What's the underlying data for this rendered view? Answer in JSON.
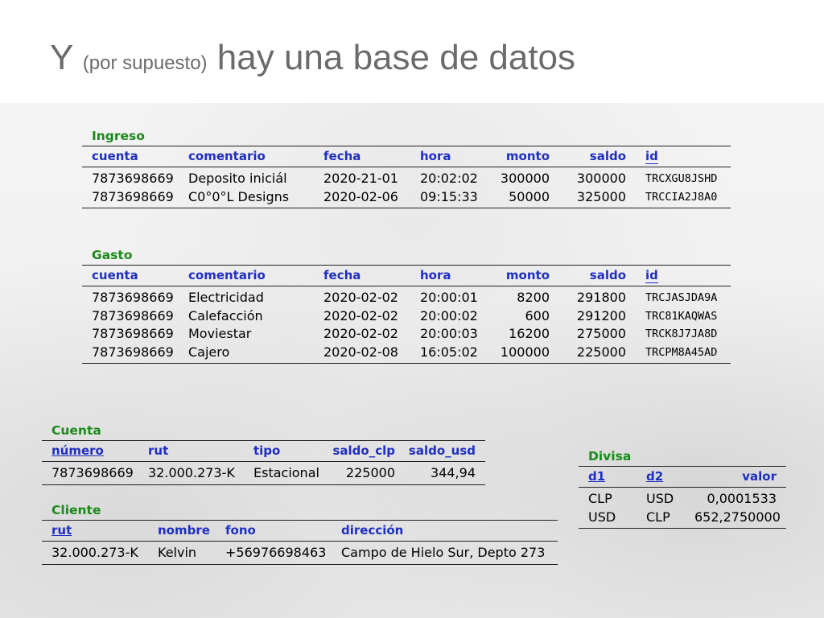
{
  "slide": {
    "title_pre": "Y",
    "title_paren": "(por supuesto)",
    "title_post": "hay una base de datos"
  },
  "ingreso": {
    "caption": "Ingreso",
    "headers": [
      "cuenta",
      "comentario",
      "fecha",
      "hora",
      "monto",
      "saldo",
      "id"
    ],
    "rows": [
      [
        "7873698669",
        "Deposito iniciál",
        "2020-21-01",
        "20:02:02",
        "300000",
        "300000",
        "TRCXGU8JSHD"
      ],
      [
        "7873698669",
        "C0°0°L Designs",
        "2020-02-06",
        "09:15:33",
        "50000",
        "325000",
        "TRCCIA2J8A0"
      ]
    ]
  },
  "gasto": {
    "caption": "Gasto",
    "headers": [
      "cuenta",
      "comentario",
      "fecha",
      "hora",
      "monto",
      "saldo",
      "id"
    ],
    "rows": [
      [
        "7873698669",
        "Electricidad",
        "2020-02-02",
        "20:00:01",
        "8200",
        "291800",
        "TRCJASJDA9A"
      ],
      [
        "7873698669",
        "Calefacción",
        "2020-02-02",
        "20:00:02",
        "600",
        "291200",
        "TRC81KAQWAS"
      ],
      [
        "7873698669",
        "Moviestar",
        "2020-02-02",
        "20:00:03",
        "16200",
        "275000",
        "TRCK8J7JA8D"
      ],
      [
        "7873698669",
        "Cajero",
        "2020-02-08",
        "16:05:02",
        "100000",
        "225000",
        "TRCPM8A45AD"
      ]
    ]
  },
  "cuenta": {
    "caption": "Cuenta",
    "headers": [
      "número",
      "rut",
      "tipo",
      "saldo_clp",
      "saldo_usd"
    ],
    "rows": [
      [
        "7873698669",
        "32.000.273-K",
        "Estacional",
        "225000",
        "344,94"
      ]
    ]
  },
  "cliente": {
    "caption": "Cliente",
    "headers": [
      "rut",
      "nombre",
      "fono",
      "dirección"
    ],
    "rows": [
      [
        "32.000.273-K",
        "Kelvin",
        "+56976698463",
        "Campo de Hielo Sur, Depto 273"
      ]
    ]
  },
  "divisa": {
    "caption": "Divisa",
    "headers": [
      "d1",
      "d2",
      "valor"
    ],
    "rows": [
      [
        "CLP",
        "USD",
        "0,0001533"
      ],
      [
        "USD",
        "CLP",
        "652,2750000"
      ]
    ]
  }
}
